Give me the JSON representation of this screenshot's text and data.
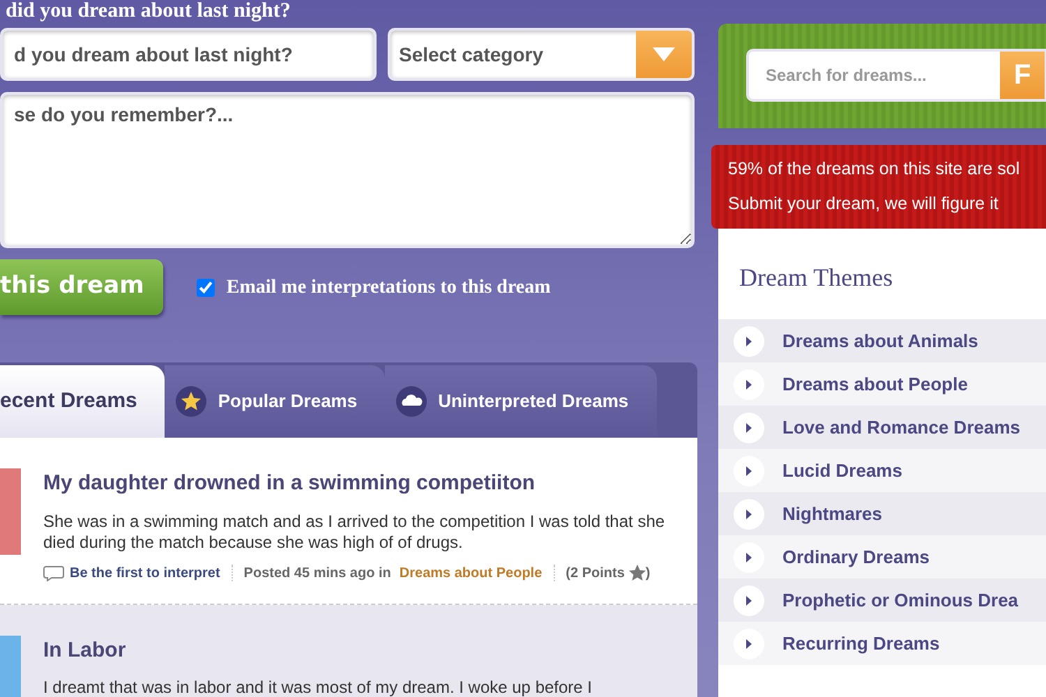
{
  "heading": "did you dream about last night?",
  "form": {
    "title_field": {
      "placeholder": "d you dream about last night?"
    },
    "category": {
      "label": "Select category"
    },
    "description": {
      "placeholder": "se do you remember?..."
    },
    "submit": "this dream",
    "email_option": {
      "label": "Email me interpretations to this dream",
      "checked": true
    }
  },
  "tabs": [
    {
      "label": "ecent Dreams",
      "selected": true,
      "kind": "plain"
    },
    {
      "label": "Popular Dreams",
      "selected": false,
      "kind": "star"
    },
    {
      "label": "Uninterpreted Dreams",
      "selected": false,
      "kind": "cloud"
    }
  ],
  "dreams": [
    {
      "title": "My daughter drowned in a swimming competiiton",
      "text": "She was in a swimming match and as I arrived to the competition I was told that she died during the match because she was high of of drugs.",
      "interpret": "Be the first to interpret",
      "posted": "Posted 45 mins ago in",
      "category": "Dreams about People",
      "points": "(2 Points",
      "points_end": ")"
    },
    {
      "title": "In Labor",
      "text": "I dreamt that was in labor and it was most of my dream. I woke up before I"
    }
  ],
  "sidebar": {
    "search": {
      "placeholder": "Search for dreams...",
      "button": "F"
    },
    "banner": [
      "59% of the dreams on this site are sol",
      "Submit your dream, we will figure it"
    ],
    "themes_title": "Dream Themes",
    "themes": [
      "Dreams about Animals",
      "Dreams about People",
      "Love and Romance Dreams",
      "Lucid Dreams",
      "Nightmares",
      "Ordinary Dreams",
      "Prophetic or Ominous Drea",
      "Recurring Dreams"
    ]
  }
}
